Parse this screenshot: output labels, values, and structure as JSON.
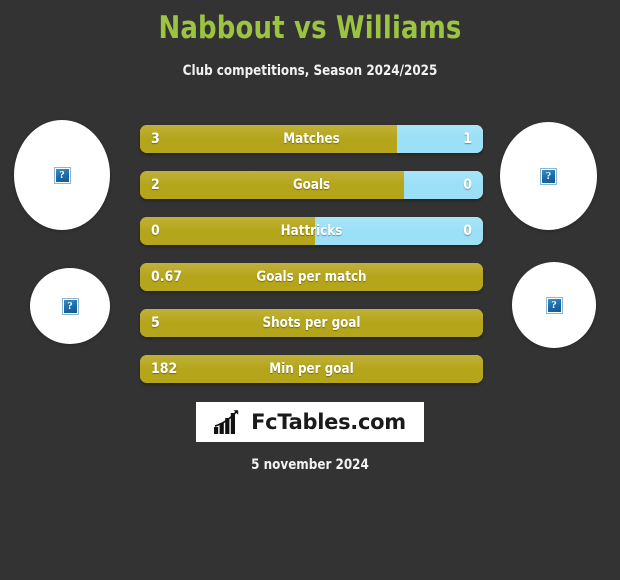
{
  "header": {
    "title": "Nabbout vs Williams",
    "subtitle": "Club competitions, Season 2024/2025",
    "title_color": "#9cc342"
  },
  "colors": {
    "background": "#333333",
    "home_bar": "#b5a51a",
    "away_bar": "#9be0f7",
    "text": "#ffffff"
  },
  "avatars": [
    {
      "position": "left-top",
      "placeholder": "broken-image-icon"
    },
    {
      "position": "left-bottom",
      "placeholder": "broken-image-icon"
    },
    {
      "position": "right-top",
      "placeholder": "broken-image-icon"
    },
    {
      "position": "right-bottom",
      "placeholder": "broken-image-icon"
    }
  ],
  "stats": [
    {
      "label": "Matches",
      "home": "3",
      "away": "1",
      "home_pct": 75,
      "split": true
    },
    {
      "label": "Goals",
      "home": "2",
      "away": "0",
      "home_pct": 77,
      "split": true
    },
    {
      "label": "Hattricks",
      "home": "0",
      "away": "0",
      "home_pct": 51,
      "split": true
    },
    {
      "label": "Goals per match",
      "home": "0.67",
      "away": "",
      "home_pct": 100,
      "split": false
    },
    {
      "label": "Shots per goal",
      "home": "5",
      "away": "",
      "home_pct": 100,
      "split": false
    },
    {
      "label": "Min per goal",
      "home": "182",
      "away": "",
      "home_pct": 100,
      "split": false
    }
  ],
  "footer": {
    "logo_text": "FcTables.com",
    "logo_icon": "bar-chart-arrow-icon",
    "date": "5 november 2024"
  }
}
